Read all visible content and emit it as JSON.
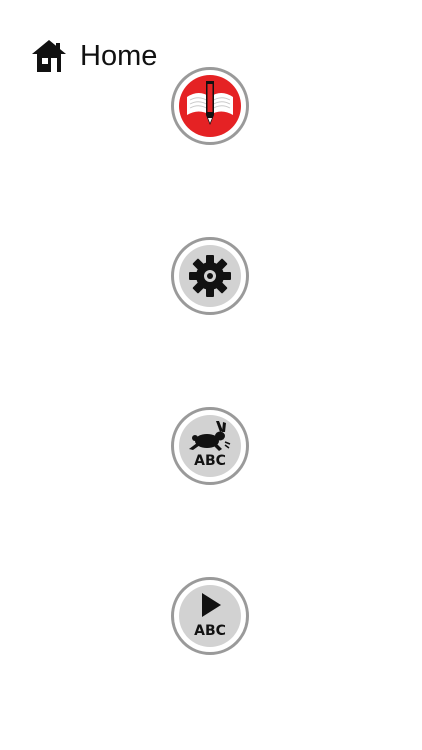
{
  "header": {
    "icon": "home-icon",
    "title": "Home"
  },
  "menu": [
    {
      "id": "book-pencil",
      "icon": "book-pencil-icon",
      "accent": "#e52224"
    },
    {
      "id": "settings",
      "icon": "gear-icon"
    },
    {
      "id": "rabbit-abc",
      "icon": "rabbit-icon",
      "text": "ABC"
    },
    {
      "id": "play-abc",
      "icon": "play-icon",
      "text": "ABC"
    }
  ],
  "colors": {
    "background": "#ffffff",
    "ring": "#9a9a9a",
    "inner": "#d2d2d2",
    "red": "#e52224",
    "icon": "#111111"
  }
}
